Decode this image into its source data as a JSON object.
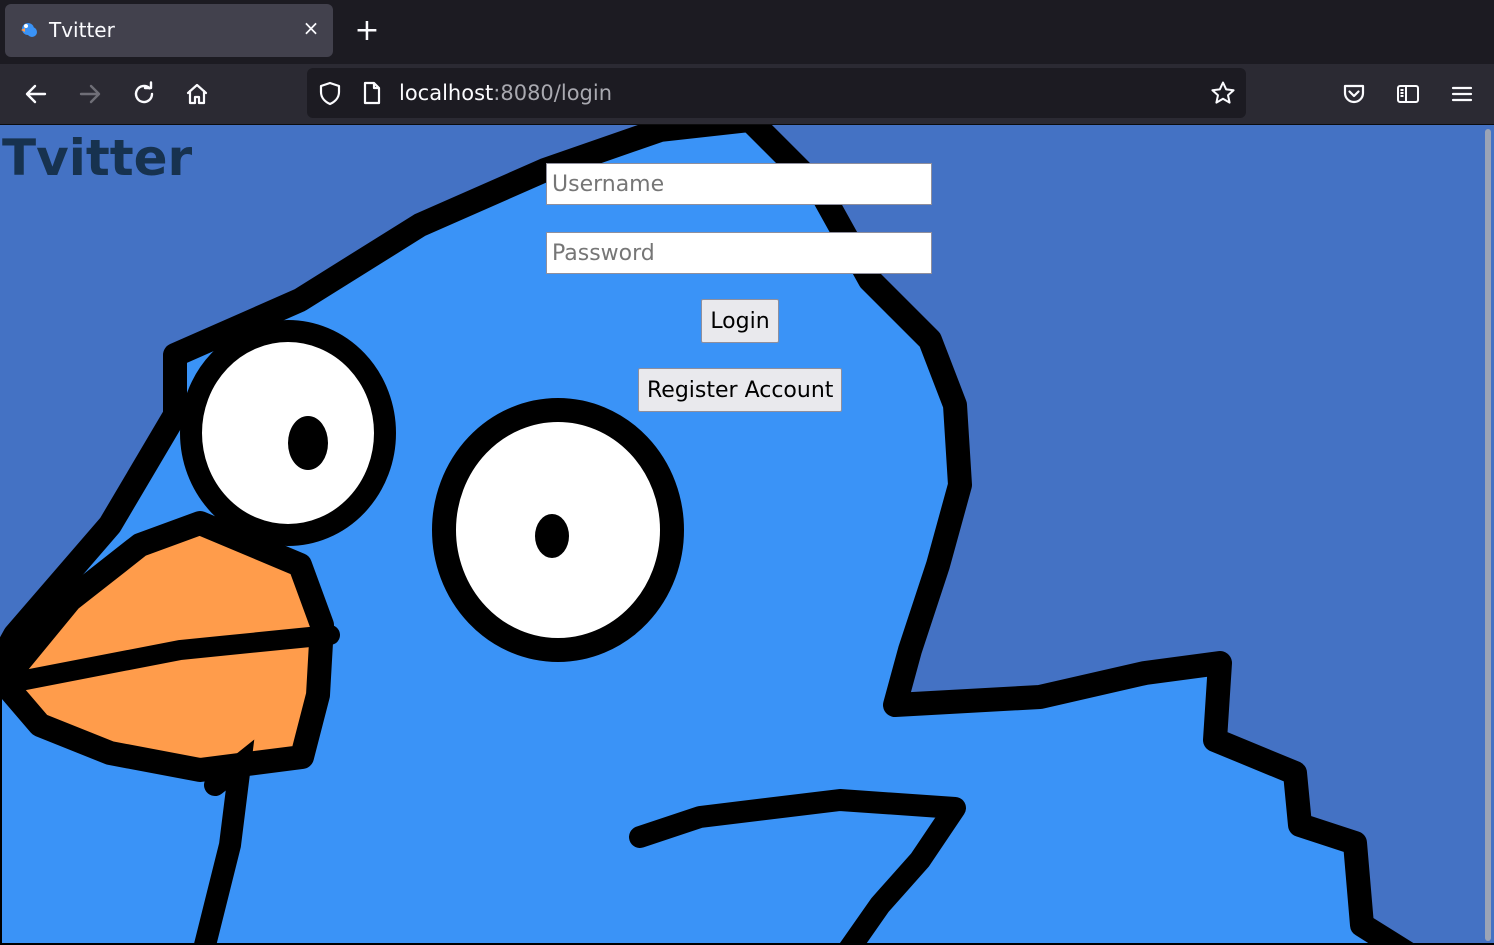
{
  "browser": {
    "tab": {
      "title": "Tvitter",
      "close_glyph": "×"
    },
    "new_tab_glyph": "+",
    "url": {
      "host": "localhost",
      "rest": ":8080/login"
    },
    "icons": {
      "back": "arrow-left-icon",
      "forward": "arrow-right-icon",
      "reload": "reload-icon",
      "home": "home-icon",
      "tracking": "shield-icon",
      "page": "page-icon",
      "bookmark": "star-icon",
      "pocket": "pocket-icon",
      "sidebar": "sidebar-icon",
      "menu": "hamburger-menu-icon"
    }
  },
  "page": {
    "site_title": "Tvitter",
    "username": {
      "placeholder": "Username",
      "value": ""
    },
    "password": {
      "placeholder": "Password",
      "value": ""
    },
    "login_label": "Login",
    "register_label": "Register Account"
  },
  "colors": {
    "page_background": "#4472c4",
    "bird_body": "#3a93f7",
    "beak": "#ff9c4b",
    "outline": "#000000",
    "title_text": "#17324f"
  }
}
